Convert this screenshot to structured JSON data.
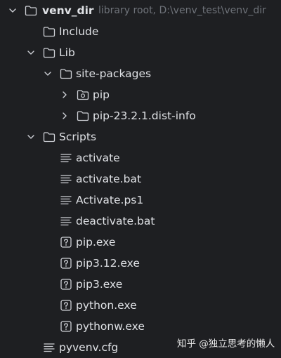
{
  "tree": {
    "root": {
      "name": "venv_dir",
      "meta": "library root,  D:\\venv_test\\venv_dir",
      "icon": "folder-icon",
      "expanded": true
    },
    "include": {
      "name": "Include",
      "icon": "folder-icon"
    },
    "lib": {
      "name": "Lib",
      "icon": "folder-icon",
      "expanded": true
    },
    "site_packages": {
      "name": "site-packages",
      "icon": "folder-icon",
      "expanded": true
    },
    "pip": {
      "name": "pip",
      "icon": "package-folder-icon",
      "expanded": false
    },
    "pip_dist_info": {
      "name": "pip-23.2.1.dist-info",
      "icon": "folder-icon",
      "expanded": false
    },
    "scripts": {
      "name": "Scripts",
      "icon": "folder-icon",
      "expanded": true
    },
    "script_files": [
      {
        "name": "activate",
        "icon": "text-file-icon"
      },
      {
        "name": "activate.bat",
        "icon": "text-file-icon"
      },
      {
        "name": "Activate.ps1",
        "icon": "text-file-icon"
      },
      {
        "name": "deactivate.bat",
        "icon": "text-file-icon"
      },
      {
        "name": "pip.exe",
        "icon": "unknown-file-icon"
      },
      {
        "name": "pip3.12.exe",
        "icon": "unknown-file-icon"
      },
      {
        "name": "pip3.exe",
        "icon": "unknown-file-icon"
      },
      {
        "name": "python.exe",
        "icon": "unknown-file-icon"
      },
      {
        "name": "pythonw.exe",
        "icon": "unknown-file-icon"
      }
    ],
    "pyvenv": {
      "name": "pyvenv.cfg",
      "icon": "text-file-icon"
    }
  },
  "watermark": "知乎 @独立思考的懒人",
  "colors": {
    "background": "#1e1f22",
    "text": "#dfe1e5",
    "muted": "#6f737a",
    "icon": "#ced0d6"
  }
}
